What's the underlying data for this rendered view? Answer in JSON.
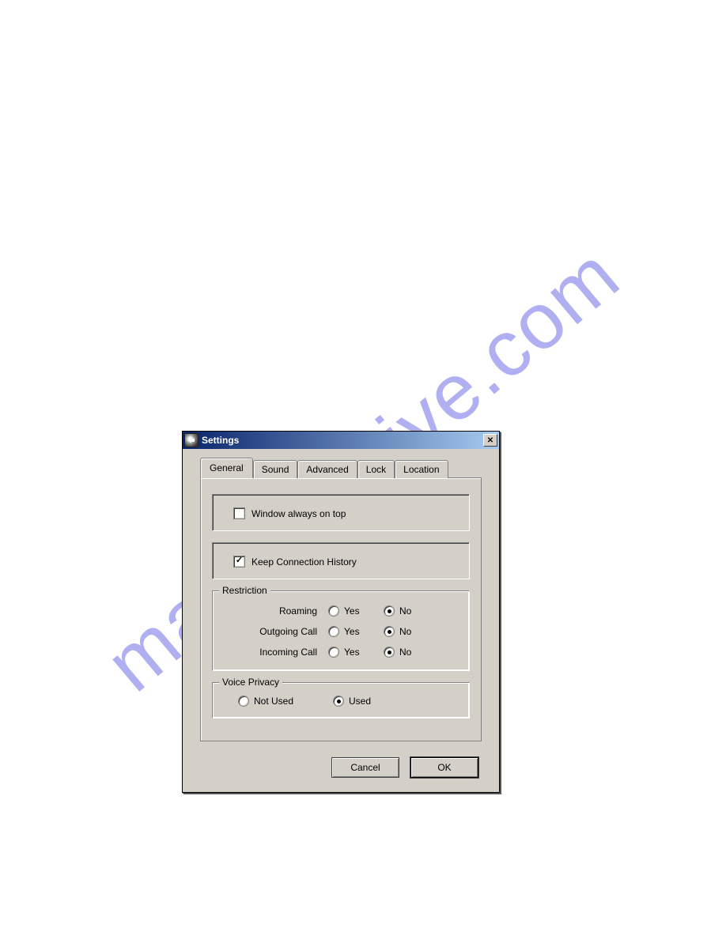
{
  "watermark": "manualshive.com",
  "dialog": {
    "title": "Settings",
    "tabs": [
      "General",
      "Sound",
      "Advanced",
      "Lock",
      "Location"
    ],
    "active_tab_index": 0,
    "general": {
      "window_on_top": {
        "label": "Window always on top",
        "checked": false
      },
      "keep_history": {
        "label": "Keep Connection History",
        "checked": true
      },
      "restriction": {
        "legend": "Restriction",
        "options": {
          "yes": "Yes",
          "no": "No"
        },
        "rows": [
          {
            "label": "Roaming",
            "value": "no"
          },
          {
            "label": "Outgoing Call",
            "value": "no"
          },
          {
            "label": "Incoming Call",
            "value": "no"
          }
        ]
      },
      "voice_privacy": {
        "legend": "Voice Privacy",
        "options": {
          "not_used": "Not Used",
          "used": "Used"
        },
        "value": "used"
      }
    },
    "buttons": {
      "cancel": "Cancel",
      "ok": "OK"
    }
  }
}
